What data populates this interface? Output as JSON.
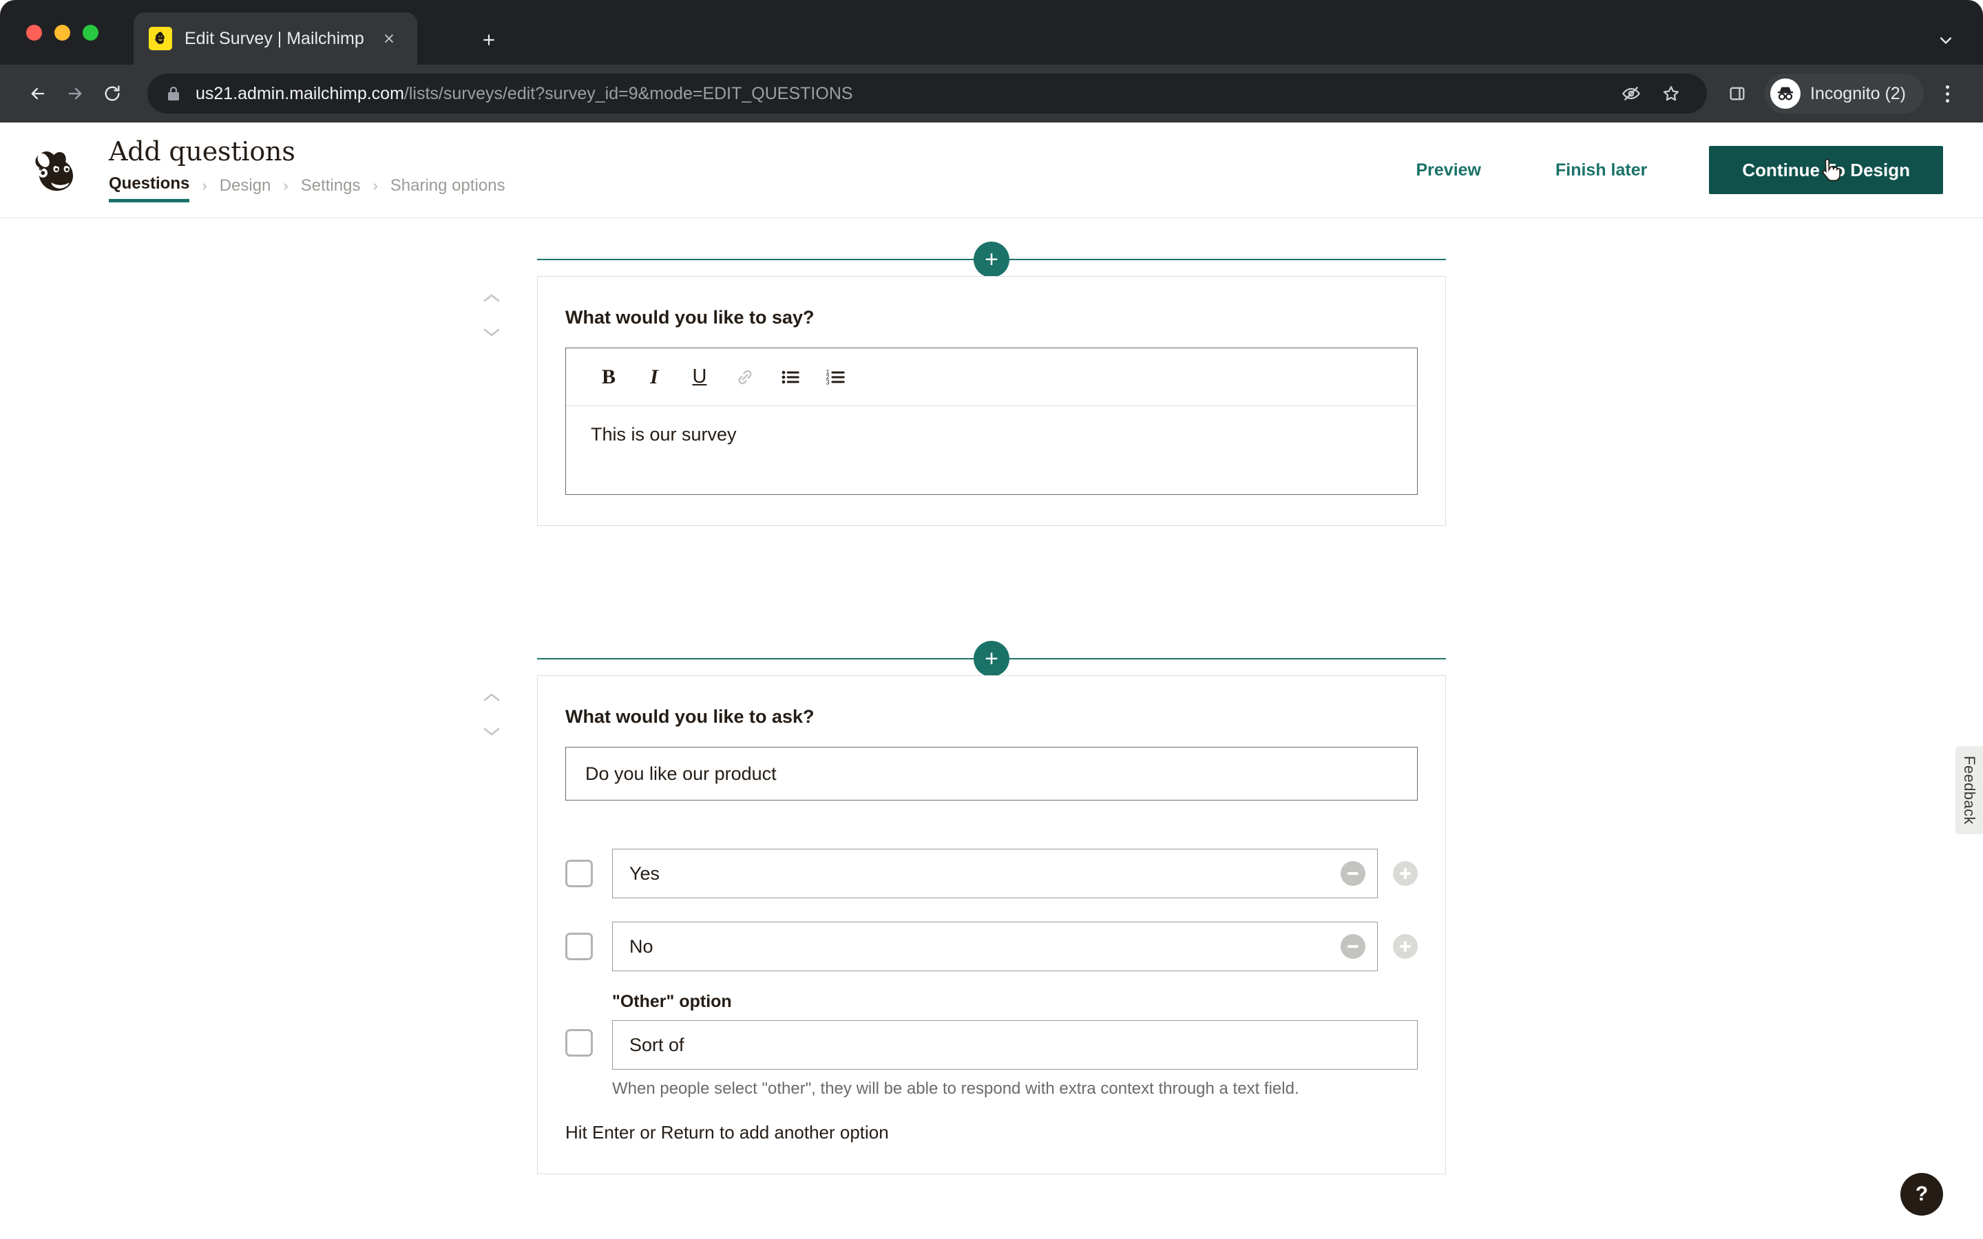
{
  "browser": {
    "tab": {
      "title": "Edit Survey | Mailchimp",
      "favicon": "mailchimp-favicon-icon"
    },
    "new_tab_label": "+",
    "url_host": "us21.admin.mailchimp.com",
    "url_path": "/lists/surveys/edit?survey_id=9&mode=EDIT_QUESTIONS",
    "profile_label": "Incognito (2)",
    "icons": {
      "back": "back-arrow-icon",
      "forward": "forward-arrow-icon",
      "reload": "reload-icon",
      "lock": "lock-icon",
      "tracking": "eye-off-icon",
      "bookmark": "star-icon",
      "side_panel": "side-panel-icon",
      "menu": "kebab-menu-icon",
      "tab_list": "chevron-down-icon"
    }
  },
  "header": {
    "logo": "mailchimp-freddie-logo",
    "title": "Add questions",
    "breadcrumb": [
      {
        "label": "Questions",
        "active": true
      },
      {
        "label": "Design",
        "active": false
      },
      {
        "label": "Settings",
        "active": false
      },
      {
        "label": "Sharing options",
        "active": false
      }
    ],
    "separator": "›",
    "actions": {
      "preview": "Preview",
      "finish_later": "Finish later",
      "primary": "Continue To Design"
    }
  },
  "colors": {
    "teal": "#1a7268",
    "primary_button": "#10514b",
    "ink": "#241c15",
    "muted": "#9a9a96"
  },
  "blocks": [
    {
      "type": "text-block",
      "label": "What would you like to say?",
      "content": "This is our survey",
      "toolbar": [
        {
          "name": "bold-icon",
          "label": "B",
          "disabled": false
        },
        {
          "name": "italic-icon",
          "label": "I",
          "disabled": false
        },
        {
          "name": "underline-icon",
          "label": "U",
          "disabled": false
        },
        {
          "name": "link-icon",
          "label": "",
          "disabled": true
        },
        {
          "name": "bulleted-list-icon",
          "label": "",
          "disabled": false
        },
        {
          "name": "numbered-list-icon",
          "label": "",
          "disabled": false
        }
      ]
    },
    {
      "type": "question-block",
      "label": "What would you like to ask?",
      "question": "Do you like our product",
      "options": [
        {
          "value": "Yes",
          "checked": false
        },
        {
          "value": "No",
          "checked": false
        }
      ],
      "other": {
        "label": "\"Other\" option",
        "value": "Sort of",
        "checked": false,
        "help": "When people select \"other\", they will be able to respond with extra context through a text field."
      },
      "hint": "Hit Enter or Return to add another option"
    }
  ],
  "insert_button_label": "+",
  "widgets": {
    "feedback": "Feedback",
    "help": "?"
  }
}
